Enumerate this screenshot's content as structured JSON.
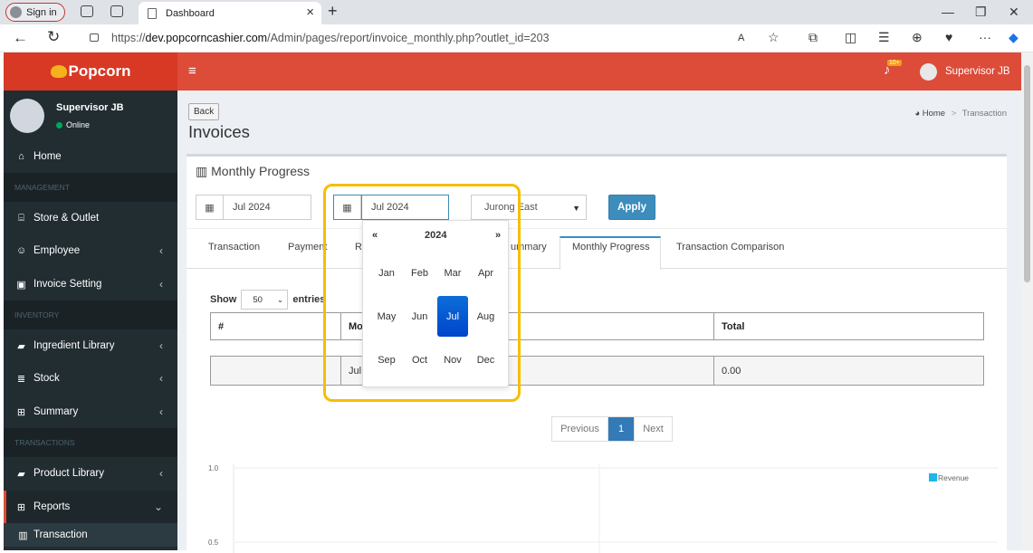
{
  "browser": {
    "signin_label": "Sign in",
    "tab_title": "Dashboard",
    "url_prefix": "https://",
    "url_domain": "dev.popcorncashier.com",
    "url_path": "/Admin/pages/report/invoice_monthly.php?outlet_id=203"
  },
  "header": {
    "brand": "Popcorn",
    "notification_count": "10+",
    "user_name": "Supervisor JB"
  },
  "sidebar": {
    "user_name": "Supervisor JB",
    "status": "Online",
    "items": [
      {
        "label": "Home",
        "icon": "home-icon"
      },
      {
        "heading": "MANAGEMENT"
      },
      {
        "label": "Store & Outlet",
        "icon": "bank-icon"
      },
      {
        "label": "Employee",
        "icon": "users-icon"
      },
      {
        "label": "Invoice Setting",
        "icon": "money-icon"
      },
      {
        "heading": "INVENTORY"
      },
      {
        "label": "Ingredient Library",
        "icon": "book-icon"
      },
      {
        "label": "Stock",
        "icon": "database-icon"
      },
      {
        "label": "Summary",
        "icon": "table-icon"
      },
      {
        "heading": "TRANSACTIONS"
      },
      {
        "label": "Product Library",
        "icon": "book-icon"
      },
      {
        "label": "Reports",
        "icon": "table-icon"
      },
      {
        "label": "Transaction",
        "icon": "bar-chart-icon"
      }
    ]
  },
  "page": {
    "back_label": "Back",
    "title": "Invoices",
    "breadcrumb_home": "Home",
    "breadcrumb_current": "Transaction",
    "box_title": "Monthly Progress"
  },
  "filters": {
    "from_month": "Jul 2024",
    "to_month": "Jul 2024",
    "outlet": "Jurong East",
    "apply_label": "Apply"
  },
  "tabs": [
    "Transaction",
    "Payment",
    "Re",
    "ummary",
    "Monthly Progress",
    "Transaction Comparison"
  ],
  "active_tab": "Monthly Progress",
  "table": {
    "show_label": "Show",
    "entries_value": "50",
    "entries_label": "entries",
    "headers": [
      "#",
      "Mo",
      "Total"
    ],
    "row": [
      "",
      "Jul",
      "0.00"
    ]
  },
  "pagination": {
    "prev": "Previous",
    "page": "1",
    "next": "Next"
  },
  "datepicker": {
    "year": "2024",
    "prev": "«",
    "next": "»",
    "months": [
      "Jan",
      "Feb",
      "Mar",
      "Apr",
      "May",
      "Jun",
      "Jul",
      "Aug",
      "Sep",
      "Oct",
      "Nov",
      "Dec"
    ],
    "selected": "Jul"
  },
  "chart_data": {
    "type": "bar",
    "categories": [],
    "series": [
      {
        "name": "Revenue",
        "values": []
      }
    ],
    "ytick_labels": [
      "1.0",
      "0.5"
    ],
    "legend_position": "top-right",
    "legend_color": "#1ab7ea"
  }
}
